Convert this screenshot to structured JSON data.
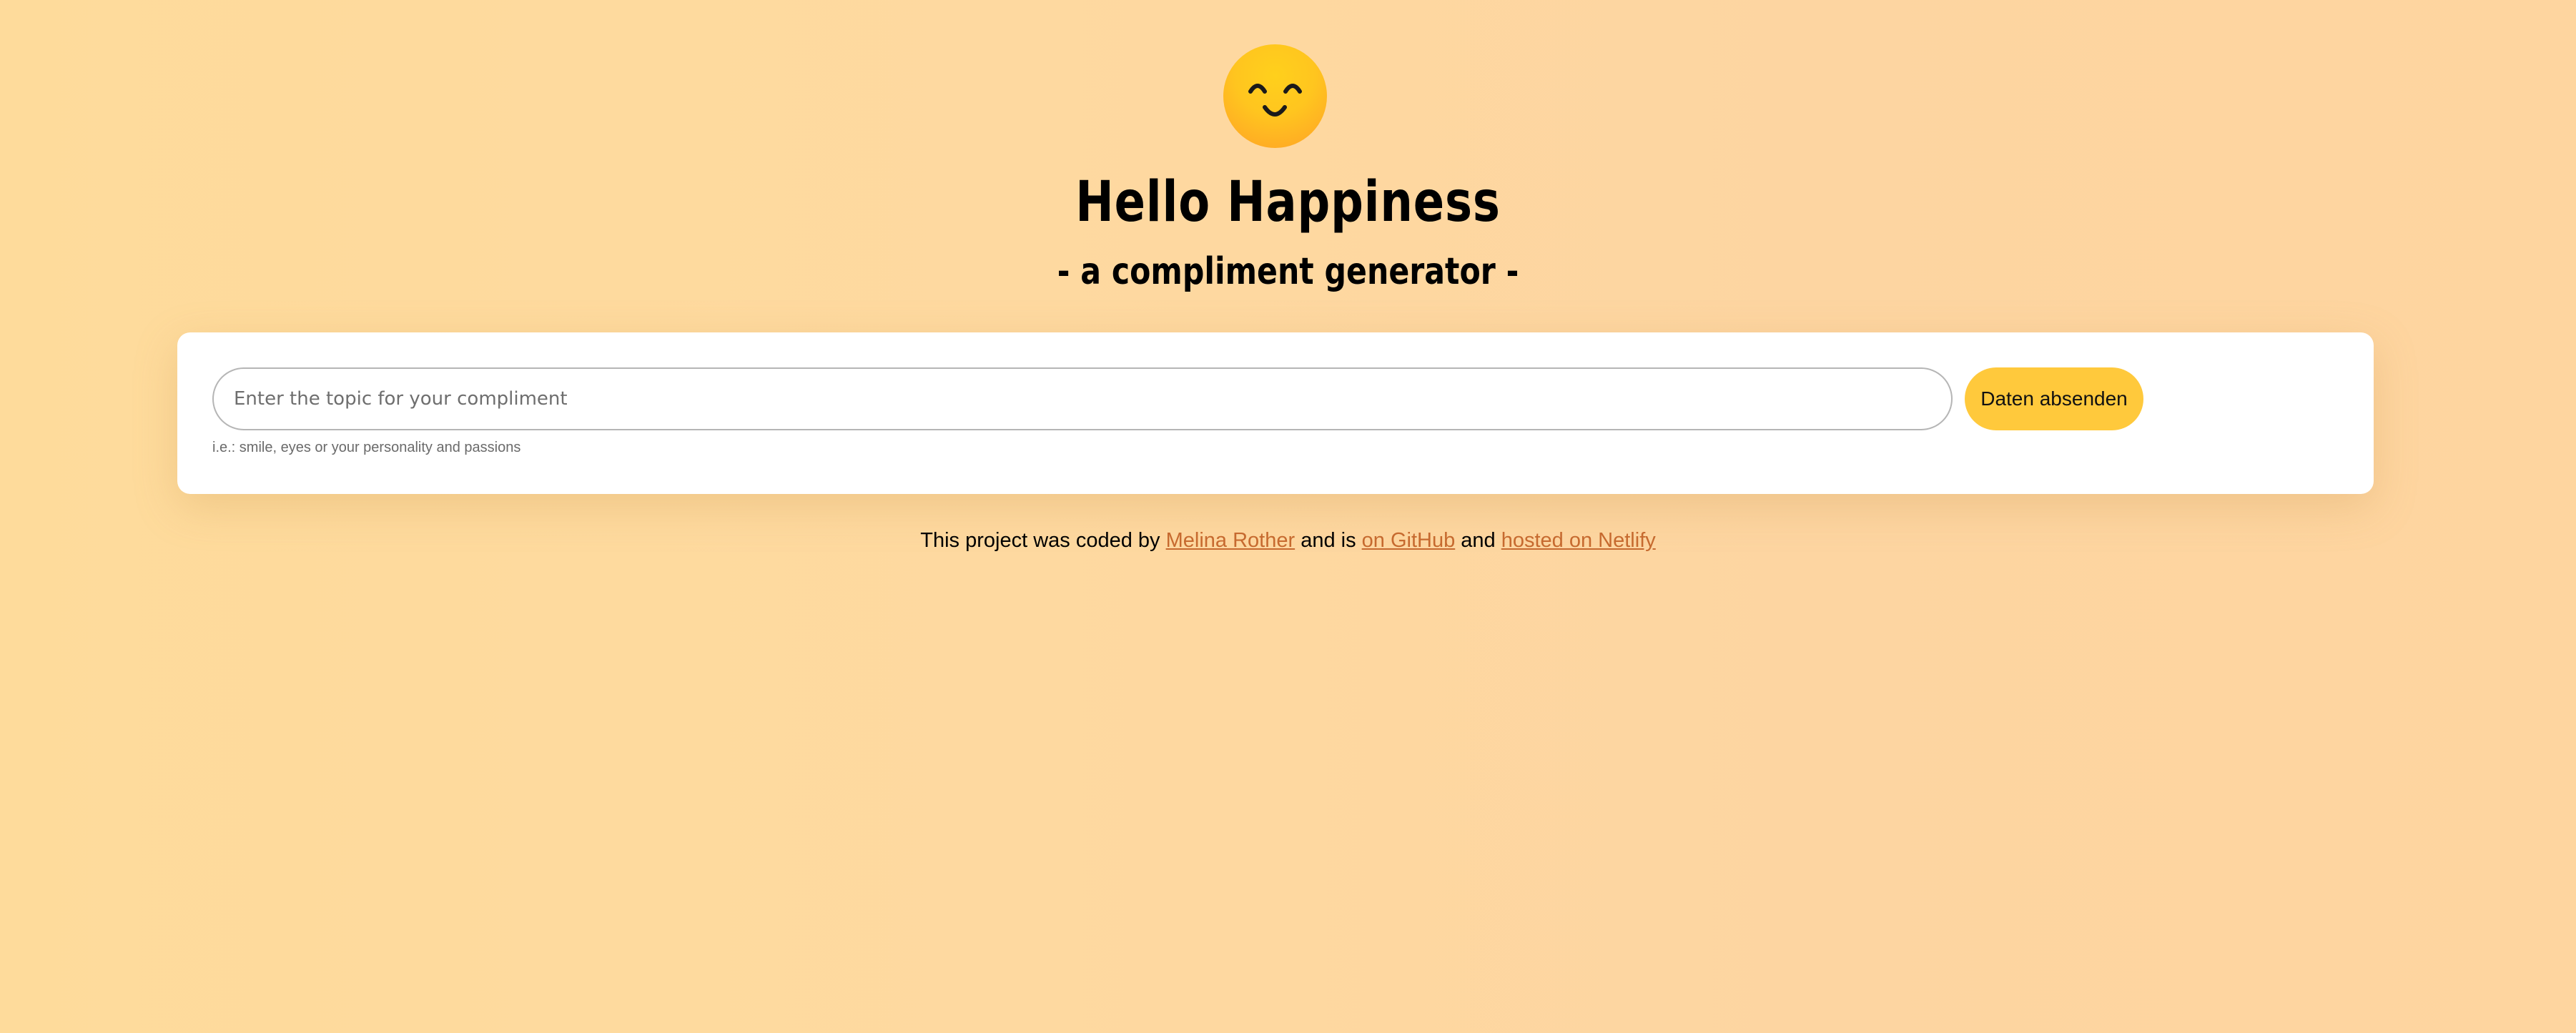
{
  "header": {
    "emoji_icon": "smiling-face-icon",
    "title": "Hello Happiness",
    "subtitle": "- a compliment generator -"
  },
  "form": {
    "input_value": "",
    "input_placeholder": "Enter the topic for your compliment",
    "submit_label": "Daten absenden",
    "hint": "i.e.: smile, eyes or your personality and passions"
  },
  "footer": {
    "text_1": "This project was coded by",
    "author_link": "Melina Rother",
    "text_2": "and is",
    "github_link": "on GitHub",
    "text_3": "and",
    "netlify_link": "hosted on Netlify"
  },
  "colors": {
    "background": "#fed9a0",
    "button": "#ffc93c",
    "link": "#c66a2f",
    "emoji": "#ffc51f"
  }
}
